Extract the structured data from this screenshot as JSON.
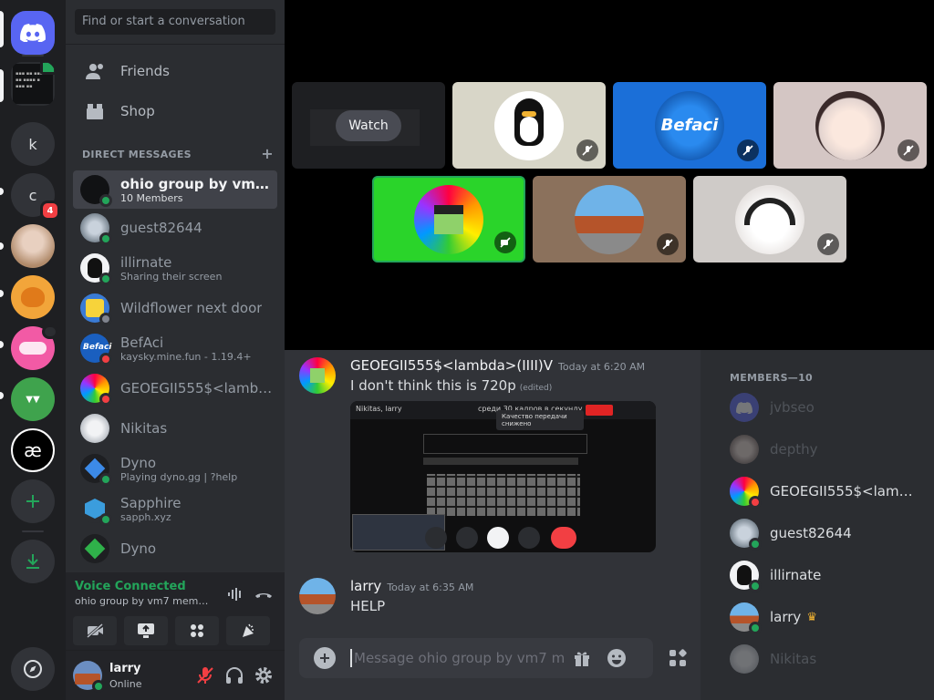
{
  "search_placeholder": "Find or start a conversation",
  "nav": {
    "friends": "Friends",
    "shop": "Shop"
  },
  "dm_header": "DIRECT MESSAGES",
  "dm_add": "+",
  "dms": [
    {
      "name": "ohio group by vm7 me...",
      "sub": "10 Members",
      "active": true
    },
    {
      "name": "guest82644",
      "sub": ""
    },
    {
      "name": "illirnate",
      "sub": "Sharing their screen"
    },
    {
      "name": "Wildflower next door",
      "sub": ""
    },
    {
      "name": "BefAci",
      "sub": "kaysky.mine.fun - 1.19.4+"
    },
    {
      "name": "GEOEGII555$<lambd...",
      "sub": ""
    },
    {
      "name": "Nikitas",
      "sub": ""
    },
    {
      "name": "Dyno",
      "sub": "Playing dyno.gg | ?help"
    },
    {
      "name": "Sapphire",
      "sub": "sapph.xyz"
    },
    {
      "name": "Dyno",
      "sub": ""
    }
  ],
  "guild_letters": {
    "k": "k",
    "c": "c"
  },
  "guild_badge": "4",
  "voice": {
    "title": "Voice Connected",
    "sub": "ohio group by vm7 member..."
  },
  "user": {
    "name": "larry",
    "status": "Online"
  },
  "stage": {
    "watch": "Watch",
    "befaci_logo": "Befaci"
  },
  "messages": [
    {
      "author": "GEOEGII555$<lambda>(IIII)V",
      "time": "Today at 6:20 AM",
      "text": "I don't think this is 720p",
      "edited": "(edited)"
    },
    {
      "author": "larry",
      "time": "Today at 6:35 AM",
      "text": "HELP"
    }
  ],
  "composer_placeholder": "Message ohio group by vm7 me...",
  "embed": {
    "notice": "Качество передачи снижено",
    "tab1": "Nikitas, larry",
    "tab2": "среди 30 кадров в секунду"
  },
  "members_header": "MEMBERS—10",
  "members": [
    {
      "name": "jvbseo",
      "dim": true
    },
    {
      "name": "depthy",
      "dim": true
    },
    {
      "name": "GEOEGII555$<lambd...",
      "dim": false
    },
    {
      "name": "guest82644",
      "dim": false
    },
    {
      "name": "illirnate",
      "dim": false
    },
    {
      "name": "larry",
      "dim": false
    },
    {
      "name": "Nikitas",
      "dim": true
    }
  ],
  "colors": {
    "online": "#23a55a",
    "dnd": "#f23f43",
    "idle": "#f0b232",
    "blurple": "#5865f2"
  }
}
